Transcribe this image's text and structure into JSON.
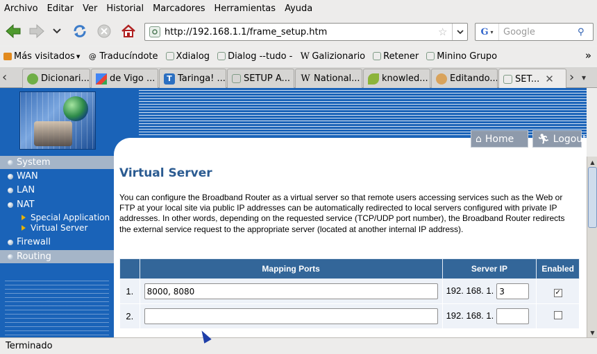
{
  "menu": {
    "items": [
      "Archivo",
      "Editar",
      "Ver",
      "Historial",
      "Marcadores",
      "Herramientas",
      "Ayuda"
    ]
  },
  "nav": {
    "url": "http://192.168.1.1/frame_setup.htm",
    "search_placeholder": "Google"
  },
  "bookmarks": {
    "items": [
      {
        "label": "Más visitados",
        "icon": "bookmark-folder-icon"
      },
      {
        "label": "Traducíndote",
        "icon": "spiral-icon"
      },
      {
        "label": "Xdialog",
        "icon": "page-icon"
      },
      {
        "label": "Dialog --tudo -",
        "icon": "page-icon"
      },
      {
        "label": "Galizionario",
        "icon": "wikipedia-icon"
      },
      {
        "label": "Retener",
        "icon": "page-icon"
      },
      {
        "label": "Minino Grupo",
        "icon": "page-icon"
      }
    ]
  },
  "tabs": {
    "items": [
      {
        "label": "Dicionari...",
        "icon": "globe-icon"
      },
      {
        "label": "de Vigo ...",
        "icon": "google-icon"
      },
      {
        "label": "Taringa! ...",
        "icon": "taringa-icon"
      },
      {
        "label": "SETUP A...",
        "icon": "page-icon"
      },
      {
        "label": "National...",
        "icon": "wikipedia-icon"
      },
      {
        "label": "knowled...",
        "icon": "leaf-icon"
      },
      {
        "label": "Editando...",
        "icon": "puzzle-icon"
      },
      {
        "label": "SET...",
        "icon": "page-icon"
      }
    ]
  },
  "header_buttons": {
    "home": "Home",
    "logout": "Logout"
  },
  "sidebar": {
    "items": [
      "System",
      "WAN",
      "LAN",
      "NAT",
      "Firewall",
      "Routing"
    ],
    "subitems": [
      "Special Application",
      "Virtual Server"
    ]
  },
  "page": {
    "title": "Virtual Server",
    "description": "You can configure the Broadband Router as a virtual server so that remote users accessing services such as the Web or FTP at your local site via public IP addresses can be automatically redirected to local servers configured with private IP addresses. In other words, depending on the requested service (TCP/UDP port number), the Broadband Router redirects the external service request to the appropriate server (located at another internal IP address)."
  },
  "table": {
    "headers": [
      "",
      "Mapping Ports",
      "Server IP",
      "Enabled"
    ],
    "ip_prefix": "192. 168. 1.",
    "rows": [
      {
        "num": "1.",
        "ports": "8000, 8080",
        "ip_last": "3",
        "enabled": true
      },
      {
        "num": "2.",
        "ports": "",
        "ip_last": "",
        "enabled": false
      }
    ]
  },
  "status": {
    "text": "Terminado"
  }
}
